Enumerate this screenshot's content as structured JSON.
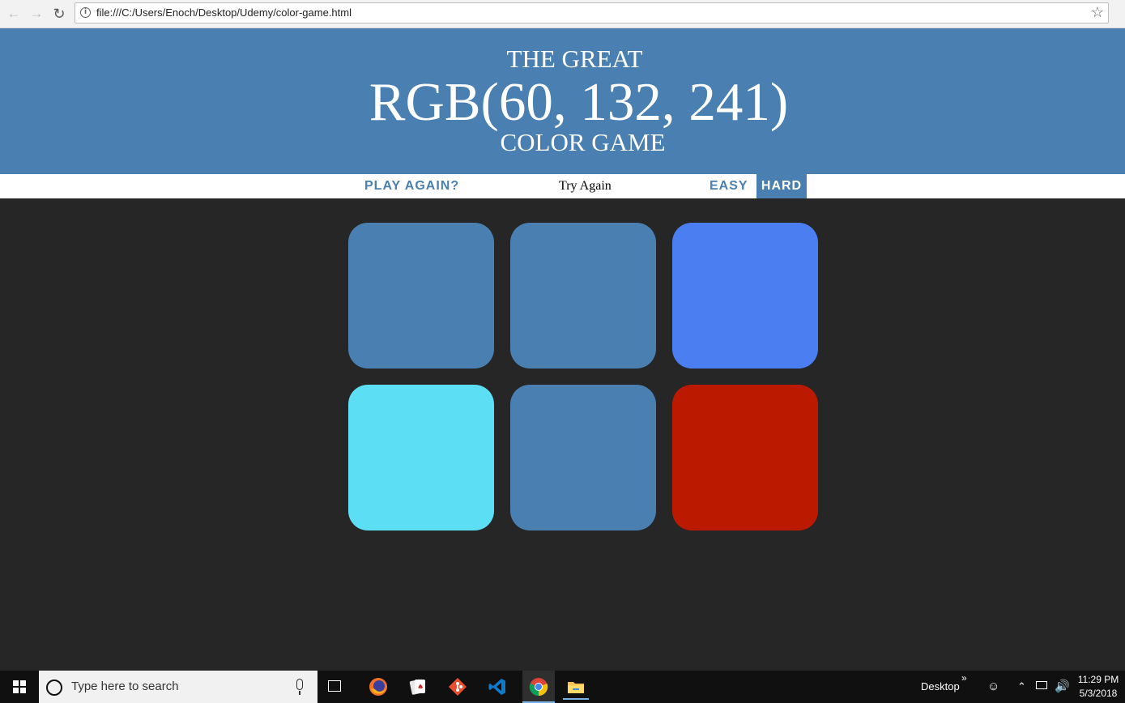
{
  "browser": {
    "address": "file:///C:/Users/Enoch/Desktop/Udemy/color-game.html"
  },
  "header": {
    "title_top": "THE GREAT",
    "rgb_display": "RGB(60, 132, 241)",
    "title_bottom": "COLOR GAME",
    "background_color": "#4a7fb1"
  },
  "stripe": {
    "play_again_label": "PLAY AGAIN?",
    "message": "Try Again",
    "easy_label": "EASY",
    "hard_label": "HARD",
    "selected_mode": "HARD"
  },
  "squares": [
    {
      "color": "#4a7fb1"
    },
    {
      "color": "#4a7fb1"
    },
    {
      "color": "#4a7ef1"
    },
    {
      "color": "#5cdff5"
    },
    {
      "color": "#4a7fb1"
    },
    {
      "color": "#bc1a00"
    }
  ],
  "taskbar": {
    "search_placeholder": "Type here to search",
    "desktop_label": "Desktop",
    "time": "11:29 PM",
    "date": "5/3/2018",
    "apps": [
      "firefox-icon",
      "solitaire-icon",
      "git-icon",
      "vscode-icon",
      "chrome-icon",
      "file-explorer-icon"
    ]
  }
}
